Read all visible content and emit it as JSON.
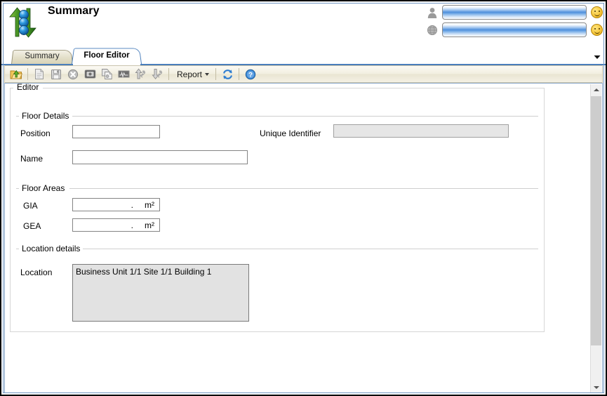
{
  "window": {
    "title": "Summary",
    "logo_icon": "green-arrows-blue-spheres-logo"
  },
  "header": {
    "user_row": {
      "icon": "user-icon",
      "value": "",
      "placeholder": "",
      "status_icon": "smiley-face-icon"
    },
    "org_row": {
      "icon": "globe-icon",
      "value": "",
      "placeholder": "",
      "status_icon": "smiley-face-icon"
    }
  },
  "tabs": {
    "items": [
      {
        "label": "Summary",
        "active": false
      },
      {
        "label": "Floor Editor",
        "active": true
      }
    ],
    "overflow_icon": "chevron-down-icon"
  },
  "toolbar": {
    "buttons": [
      {
        "name": "open-folder-button",
        "icon": "folder-up-arrow-icon",
        "enabled": true
      },
      {
        "name": "new-document-button",
        "icon": "document-icon",
        "enabled": false
      },
      {
        "name": "save-button",
        "icon": "floppy-disk-icon",
        "enabled": false
      },
      {
        "name": "delete-button",
        "icon": "cancel-circle-icon",
        "enabled": false
      },
      {
        "name": "view-button",
        "icon": "monitor-icon",
        "enabled": false
      },
      {
        "name": "copy-button",
        "icon": "copy-documents-icon",
        "enabled": false
      },
      {
        "name": "chart-button",
        "icon": "waveform-icon",
        "enabled": false
      },
      {
        "name": "move-up-button",
        "icon": "up-arrow-key-icon",
        "enabled": false
      },
      {
        "name": "move-down-button",
        "icon": "down-arrow-key-icon",
        "enabled": false
      }
    ],
    "report_label": "Report",
    "report_caret_icon": "caret-down-icon",
    "refresh_icon": "refresh-sync-icon",
    "help_icon": "help-question-icon"
  },
  "editor": {
    "group_caption": "Editor",
    "sections": {
      "floor_details": {
        "caption": "Floor Details",
        "position_label": "Position",
        "position_value": "",
        "name_label": "Name",
        "name_value": "",
        "unique_identifier_label": "Unique Identifier",
        "unique_identifier_value": ""
      },
      "floor_areas": {
        "caption": "Floor Areas",
        "gia_label": "GIA",
        "gia_value": ".",
        "gia_unit": "m²",
        "gea_label": "GEA",
        "gea_value": ".",
        "gea_unit": "m²"
      },
      "location_details": {
        "caption": "Location details",
        "location_label": "Location",
        "location_value": "Business Unit 1/1 Site 1/1 Building 1"
      }
    }
  },
  "scrollbar": {
    "up_icon": "chevron-up-icon",
    "down_icon": "chevron-down-icon"
  },
  "colors": {
    "accent_blue": "#4a7ebb",
    "tab_tan": "#e3dfc9",
    "toolbar_bg": "#f2efe0",
    "readonly_grey": "#e6e6e6"
  }
}
